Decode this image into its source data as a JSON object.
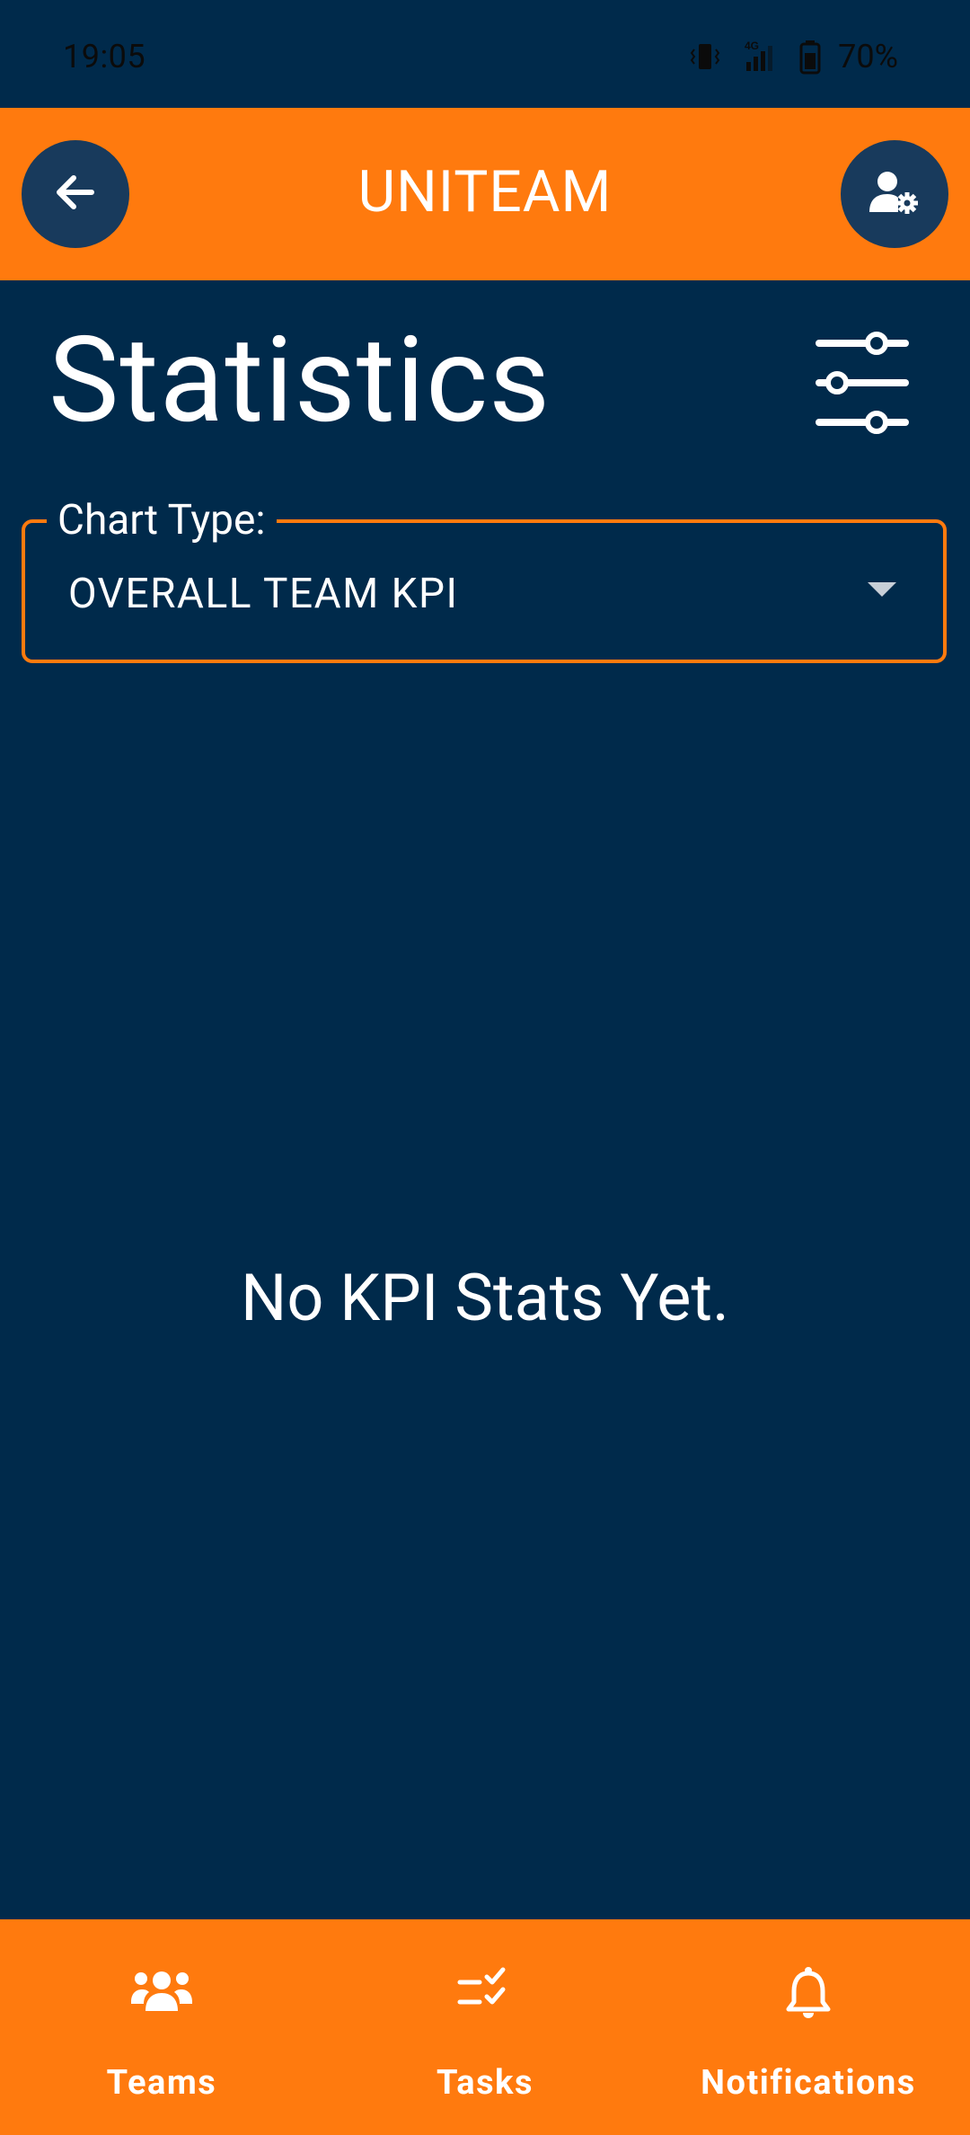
{
  "status_bar": {
    "time": "19:05",
    "battery": "70%",
    "network": "4G"
  },
  "app_bar": {
    "title": "UNITEAM"
  },
  "page": {
    "title": "Statistics"
  },
  "chart_type": {
    "label": "Chart Type:",
    "selected": "OVERALL TEAM KPI"
  },
  "empty_state": {
    "message": "No KPI Stats Yet."
  },
  "bottom_nav": {
    "items": [
      {
        "label": "Teams",
        "icon": "teams-icon"
      },
      {
        "label": "Tasks",
        "icon": "tasks-icon"
      },
      {
        "label": "Notifications",
        "icon": "bell-icon"
      }
    ]
  },
  "colors": {
    "background": "#002a4b",
    "accent": "#ff7a0e",
    "button_circle": "#183a5c"
  }
}
